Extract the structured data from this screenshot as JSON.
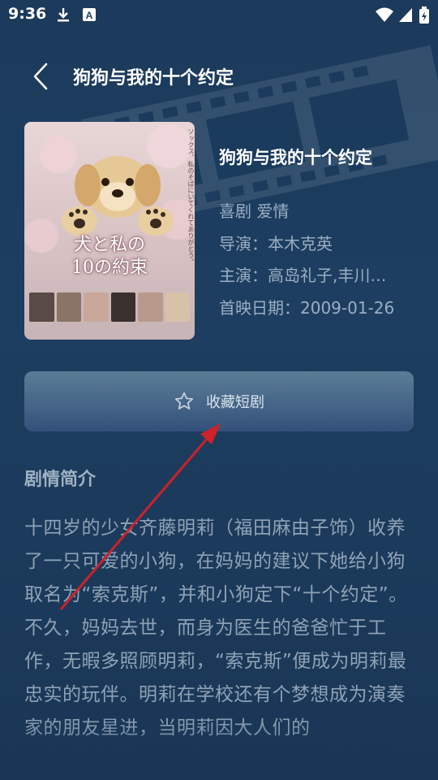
{
  "status_bar": {
    "time": "9:36",
    "icons": [
      "download-icon",
      "app-notification-icon",
      "wifi-icon",
      "signal-icon",
      "battery-icon"
    ]
  },
  "header": {
    "back_icon": "chevron-left-icon",
    "title": "狗狗与我的十个约定"
  },
  "poster": {
    "title_line1": "犬と私の",
    "title_line2": "10の約束",
    "caption": "ソックス、私のそばにいてくれてありがとう。"
  },
  "movie": {
    "title": "狗狗与我的十个约定",
    "genres": "喜剧 爱情",
    "director": "导演：本木克英",
    "cast": "主演：高岛礼子,丰川…",
    "release": "首映日期：2009-01-26"
  },
  "favorite_button": {
    "icon": "star-outline-icon",
    "label": "收藏短剧"
  },
  "synopsis": {
    "heading": "剧情简介",
    "text": "十四岁的少女齐藤明莉（福田麻由子饰）收养了一只可爱的小狗，在妈妈的建议下她给小狗取名为“索克斯”，并和小狗定下“十个约定”。不久，妈妈去世，而身为医生的爸爸忙于工作，无暇多照顾明莉，“索克斯”便成为明莉最忠实的玩伴。明莉在学校还有个梦想成为演奏家的朋友星进，当明莉因大人们的"
  },
  "colors": {
    "background": "#1b3a5c",
    "button": "#4a6a8a",
    "muted_text": "#9aaec4",
    "annotation_arrow": "#d0202a"
  }
}
